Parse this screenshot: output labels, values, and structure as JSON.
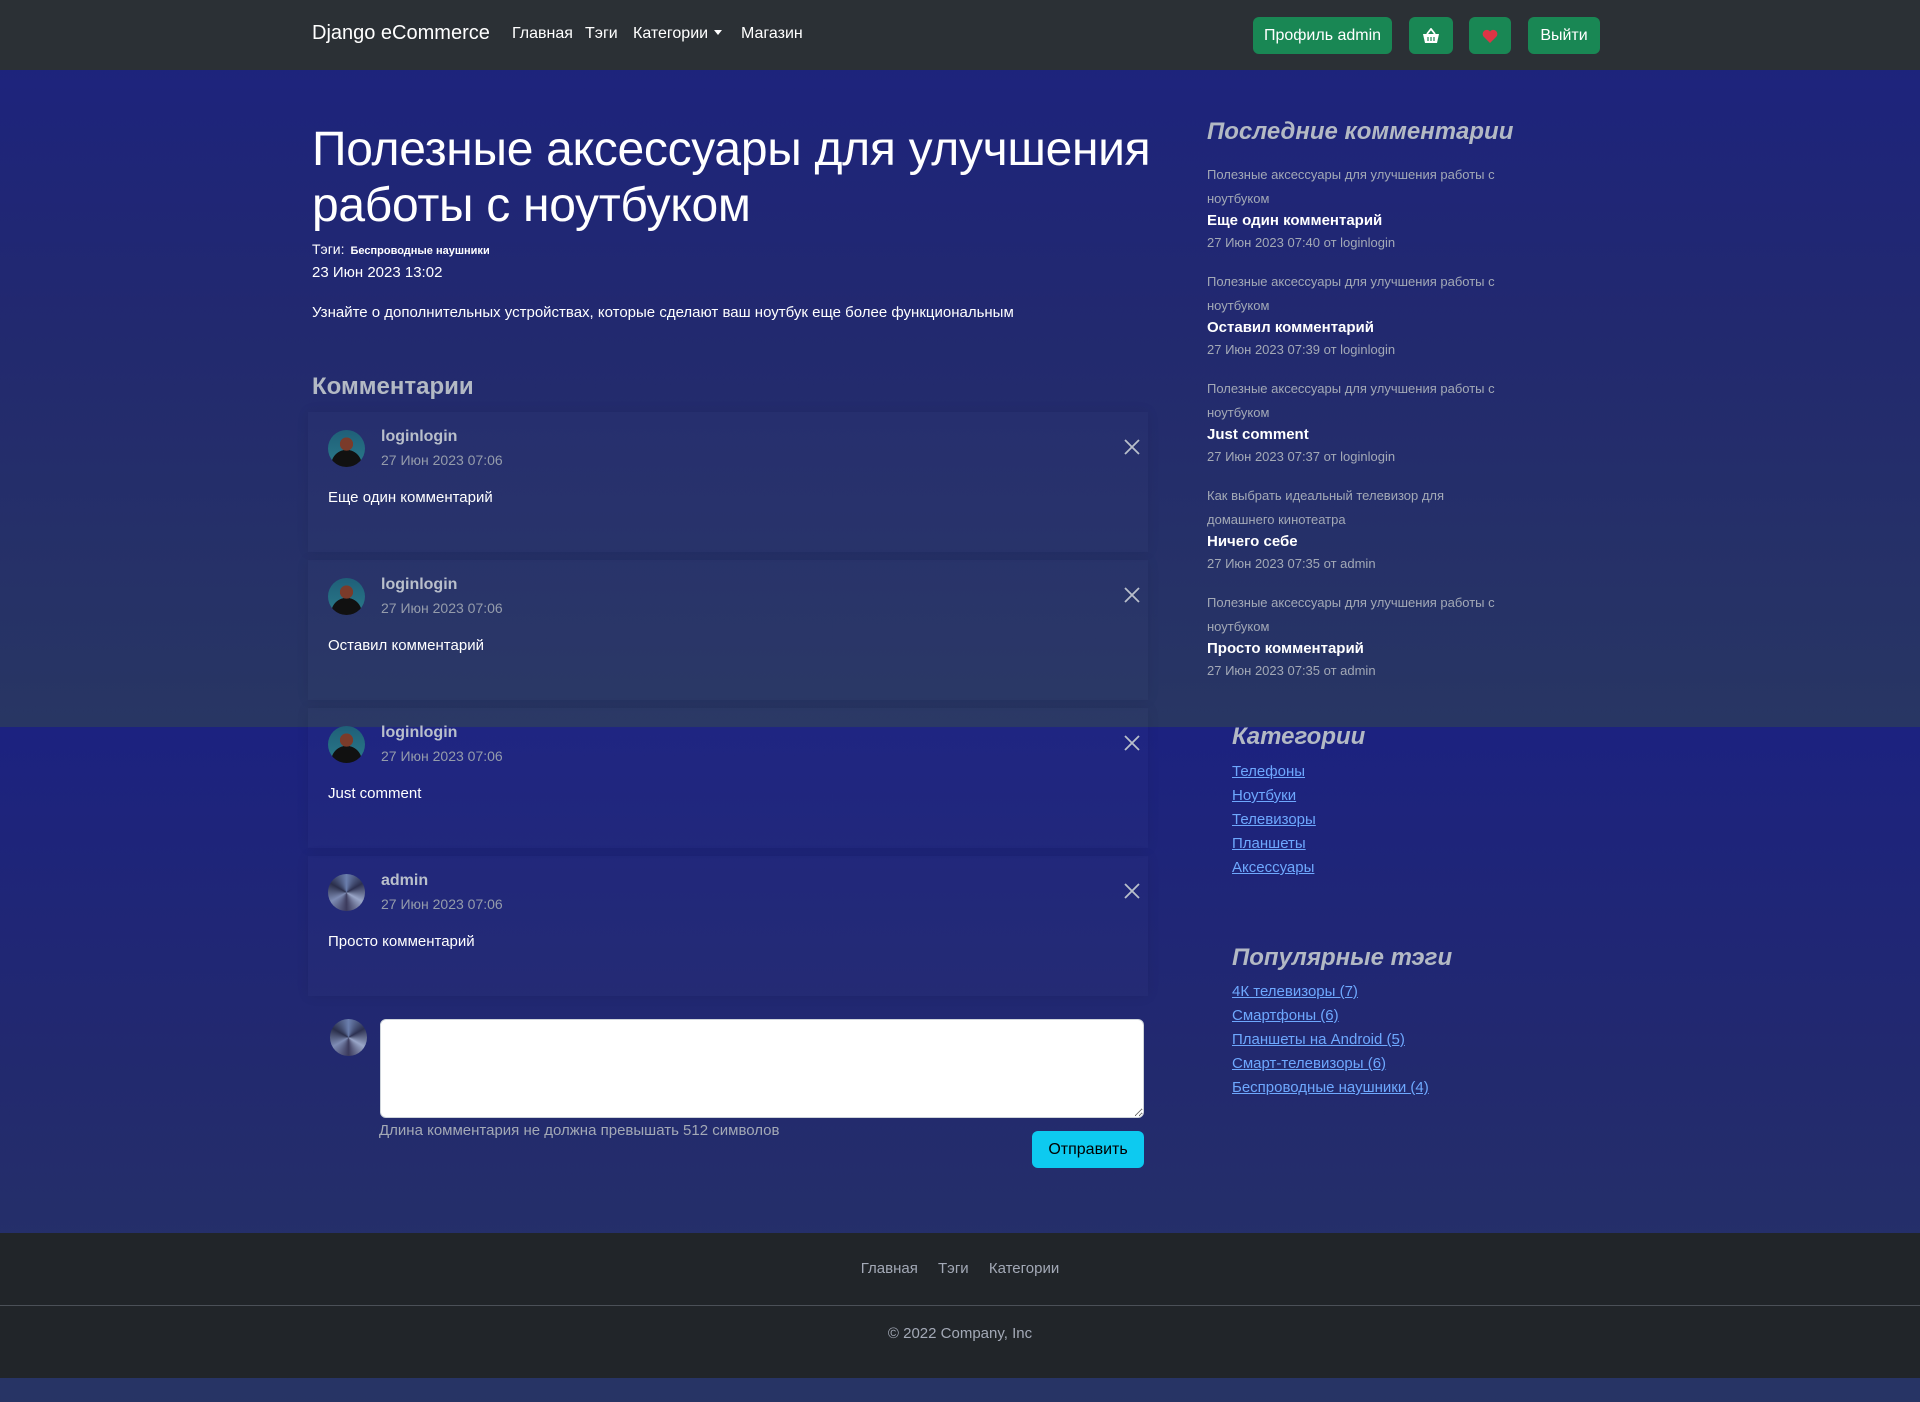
{
  "navbar": {
    "brand": "Django eCommerce",
    "links": [
      "Главная",
      "Тэги",
      "Категории",
      "Магазин"
    ],
    "profile_button": "Профиль admin",
    "cart_icon": "basket-icon",
    "wishlist_icon": "heart-icon",
    "logout_button": "Выйти"
  },
  "post": {
    "title": "Полезные аксессуары для улучшения работы с ноутбуком",
    "tags_label": "Тэги:",
    "tag": "Беспроводные наушники",
    "date": "23 Июн 2023 13:02",
    "description": "Узнайте о дополнительных устройствах, которые сделают ваш ноутбук еще более функциональным"
  },
  "comments": {
    "heading": "Комментарии",
    "items": [
      {
        "author": "loginlogin",
        "date": "27 Июн 2023 07:06",
        "text": "Еще один комментарий"
      },
      {
        "author": "loginlogin",
        "date": "27 Июн 2023 07:06",
        "text": "Оставил комментарий"
      },
      {
        "author": "loginlogin",
        "date": "27 Июн 2023 07:06",
        "text": "Just comment"
      },
      {
        "author": "admin",
        "date": "27 Июн 2023 07:06",
        "text": "Просто комментарий"
      }
    ],
    "form": {
      "value": "",
      "help": "Длина комментария не должна превышать 512 символов",
      "submit": "Отправить"
    }
  },
  "sidebar": {
    "recent_heading": "Последние комментарии",
    "recent": [
      {
        "post": "Полезные аксессуары для улучшения работы с ноутбуком",
        "text": "Еще один комментарий",
        "meta": "27 Июн 2023 07:40 от loginlogin"
      },
      {
        "post": "Полезные аксессуары для улучшения работы с ноутбуком",
        "text": "Оставил комментарий",
        "meta": "27 Июн 2023 07:39 от loginlogin"
      },
      {
        "post": "Полезные аксессуары для улучшения работы с ноутбуком",
        "text": "Just comment",
        "meta": "27 Июн 2023 07:37 от loginlogin"
      },
      {
        "post": "Как выбрать идеальный телевизор для домашнего кинотеатра",
        "text": "Ничего себе",
        "meta": "27 Июн 2023 07:35 от admin"
      },
      {
        "post": "Полезные аксессуары для улучшения работы с ноутбуком",
        "text": "Просто комментарий",
        "meta": "27 Июн 2023 07:35 от admin"
      }
    ],
    "categories_heading": "Категории",
    "categories": [
      "Телефоны",
      "Ноутбуки",
      "Телевизоры",
      "Планшеты",
      "Аксессуары"
    ],
    "tags_heading": "Популярные тэги",
    "tags": [
      "4К телевизоры (7)",
      "Смартфоны (6)",
      "Планшеты на Android (5)",
      "Смарт-телевизоры (6)",
      "Беспроводные наушники (4)"
    ]
  },
  "footer": {
    "links": [
      "Главная",
      "Тэги",
      "Категории"
    ],
    "copyright": "© 2022 Company, Inc"
  },
  "colors": {
    "navbar": "#2b3035",
    "success": "#198754",
    "info": "#0dcaf0",
    "link": "#6ea8fe",
    "footer": "#212529",
    "heart": "#dc3545"
  }
}
